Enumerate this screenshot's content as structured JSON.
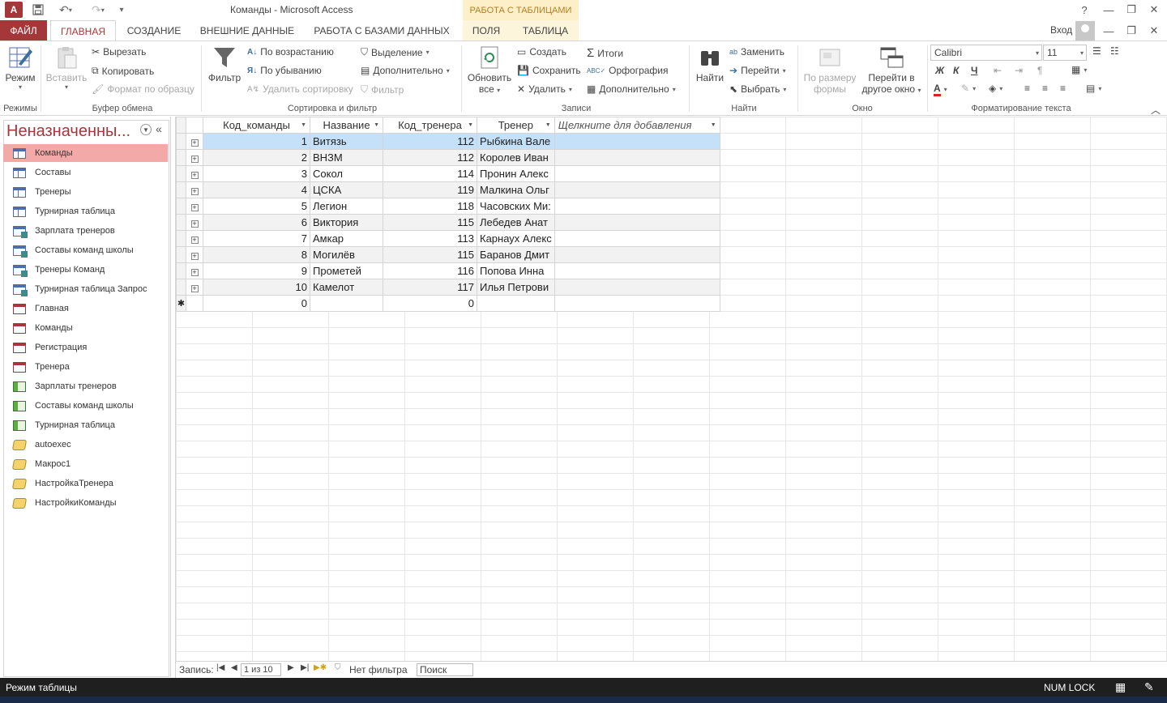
{
  "window": {
    "title": "Команды - Microsoft Access",
    "context_header": "РАБОТА С ТАБЛИЦАМИ",
    "app_icon_letter": "A",
    "controls": [
      "?",
      "—",
      "❐",
      "✕"
    ]
  },
  "tabs": {
    "file": "ФАЙЛ",
    "home": "ГЛАВНАЯ",
    "create": "СОЗДАНИЕ",
    "external": "ВНЕШНИЕ ДАННЫЕ",
    "database": "РАБОТА С БАЗАМИ ДАННЫХ",
    "fields": "ПОЛЯ",
    "table": "ТАБЛИЦА",
    "signin": "Вход"
  },
  "ribbon": {
    "views": {
      "mode": "Режим",
      "label": "Режимы"
    },
    "clipboard": {
      "paste": "Вставить",
      "cut": "Вырезать",
      "copy": "Копировать",
      "format_painter": "Формат по образцу",
      "label": "Буфер обмена"
    },
    "sort_filter": {
      "filter": "Фильтр",
      "asc": "По возрастанию",
      "desc": "По убыванию",
      "remove_sort": "Удалить сортировку",
      "selection": "Выделение",
      "advanced": "Дополнительно",
      "toggle_filter": "Фильтр",
      "label": "Сортировка и фильтр"
    },
    "records": {
      "refresh_1": "Обновить",
      "refresh_2": "все",
      "new": "Создать",
      "save": "Сохранить",
      "delete": "Удалить",
      "totals": "Итоги",
      "spelling": "Орфография",
      "more": "Дополнительно",
      "label": "Записи"
    },
    "find": {
      "find": "Найти",
      "replace": "Заменить",
      "goto": "Перейти",
      "select": "Выбрать",
      "label": "Найти"
    },
    "window": {
      "size_1": "По размеру",
      "size_2": "формы",
      "switch_1": "Перейти в",
      "switch_2": "другое окно",
      "label": "Окно"
    },
    "text_format": {
      "font": "Calibri",
      "size": "11",
      "bold": "Ж",
      "italic": "К",
      "underline": "Ч",
      "label": "Форматирование текста"
    }
  },
  "nav": {
    "title": "Неназначенны...",
    "items": [
      {
        "label": "Команды",
        "type": "table"
      },
      {
        "label": "Составы",
        "type": "table"
      },
      {
        "label": "Тренеры",
        "type": "table"
      },
      {
        "label": "Турнирная таблица",
        "type": "table"
      },
      {
        "label": "Зарплата тренеров",
        "type": "query"
      },
      {
        "label": "Составы команд школы",
        "type": "query"
      },
      {
        "label": "Тренеры Команд",
        "type": "query"
      },
      {
        "label": "Турнирная таблица Запрос",
        "type": "query"
      },
      {
        "label": "Главная",
        "type": "form"
      },
      {
        "label": "Команды",
        "type": "form"
      },
      {
        "label": "Регистрация",
        "type": "form"
      },
      {
        "label": "Тренера",
        "type": "form"
      },
      {
        "label": "Зарплаты тренеров",
        "type": "report"
      },
      {
        "label": "Составы команд школы",
        "type": "report"
      },
      {
        "label": "Турнирная таблица",
        "type": "report"
      },
      {
        "label": "autoexec",
        "type": "macro"
      },
      {
        "label": "Макрос1",
        "type": "macro"
      },
      {
        "label": "НастройкаТренера",
        "type": "macro"
      },
      {
        "label": "НастройкиКоманды",
        "type": "macro"
      }
    ]
  },
  "table": {
    "columns": [
      "Код_команды",
      "Название",
      "Код_тренера",
      "Тренер",
      "Щелкните для добавления"
    ],
    "rows": [
      [
        "1",
        "Витязь",
        "112",
        "Рыбкина Вале"
      ],
      [
        "2",
        "ВНЗМ",
        "112",
        "Королев Иван"
      ],
      [
        "3",
        "Сокол",
        "114",
        "Пронин Алекс"
      ],
      [
        "4",
        "ЦСКА",
        "119",
        "Малкина Ольг"
      ],
      [
        "5",
        "Легион",
        "118",
        "Часовских Ми:"
      ],
      [
        "6",
        "Виктория",
        "115",
        "Лебедев Анат"
      ],
      [
        "7",
        "Амкар",
        "113",
        "Карнаух Алекс"
      ],
      [
        "8",
        "Могилёв",
        "115",
        "Баранов Дмит"
      ],
      [
        "9",
        "Прометей",
        "116",
        "Попова Инна"
      ],
      [
        "10",
        "Камелот",
        "117",
        "Илья Петрови"
      ]
    ],
    "new_row": [
      "0",
      "",
      "0",
      ""
    ],
    "new_row_marker": "✱"
  },
  "record_nav": {
    "label": "Запись:",
    "position": "1 из 10",
    "filter_status": "Нет фильтра",
    "search_placeholder": "Поиск"
  },
  "status": {
    "left": "Режим таблицы",
    "numlock": "NUM LOCK"
  }
}
